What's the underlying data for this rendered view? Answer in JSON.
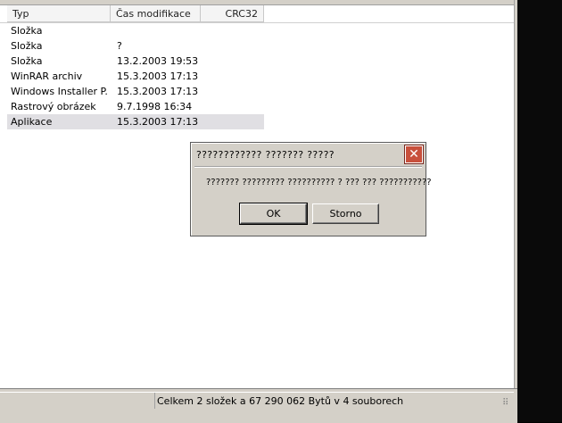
{
  "columns": {
    "typ": "Typ",
    "cas": "Čas modifikace",
    "crc": "CRC32"
  },
  "rows": [
    {
      "typ": "Složka",
      "cas": ""
    },
    {
      "typ": "Složka",
      "cas": "?"
    },
    {
      "typ": "Složka",
      "cas": "13.2.2003 19:53"
    },
    {
      "typ": "WinRAR archiv",
      "cas": "15.3.2003 17:13"
    },
    {
      "typ": "Windows Installer P...",
      "cas": "15.3.2003 17:13"
    },
    {
      "typ": "Rastrový obrázek",
      "cas": "9.7.1998 16:34"
    },
    {
      "typ": "Aplikace",
      "cas": "15.3.2003 17:13"
    }
  ],
  "selected_row": 6,
  "dialog": {
    "title": "???????????? ??????? ?????",
    "message": "??????? ????????? ?????????? ? ??? ??? ???????????",
    "ok_label": "OK",
    "cancel_label": "Storno",
    "close_glyph": "✕"
  },
  "status": {
    "text": "Celkem 2 složek a 67 290 062 Bytů v 4 souborech",
    "grip_glyph": "⠿"
  },
  "colors": {
    "selection": "#e0dfe3",
    "close_button": "#c8503c",
    "chrome": "#d4d0c8"
  }
}
